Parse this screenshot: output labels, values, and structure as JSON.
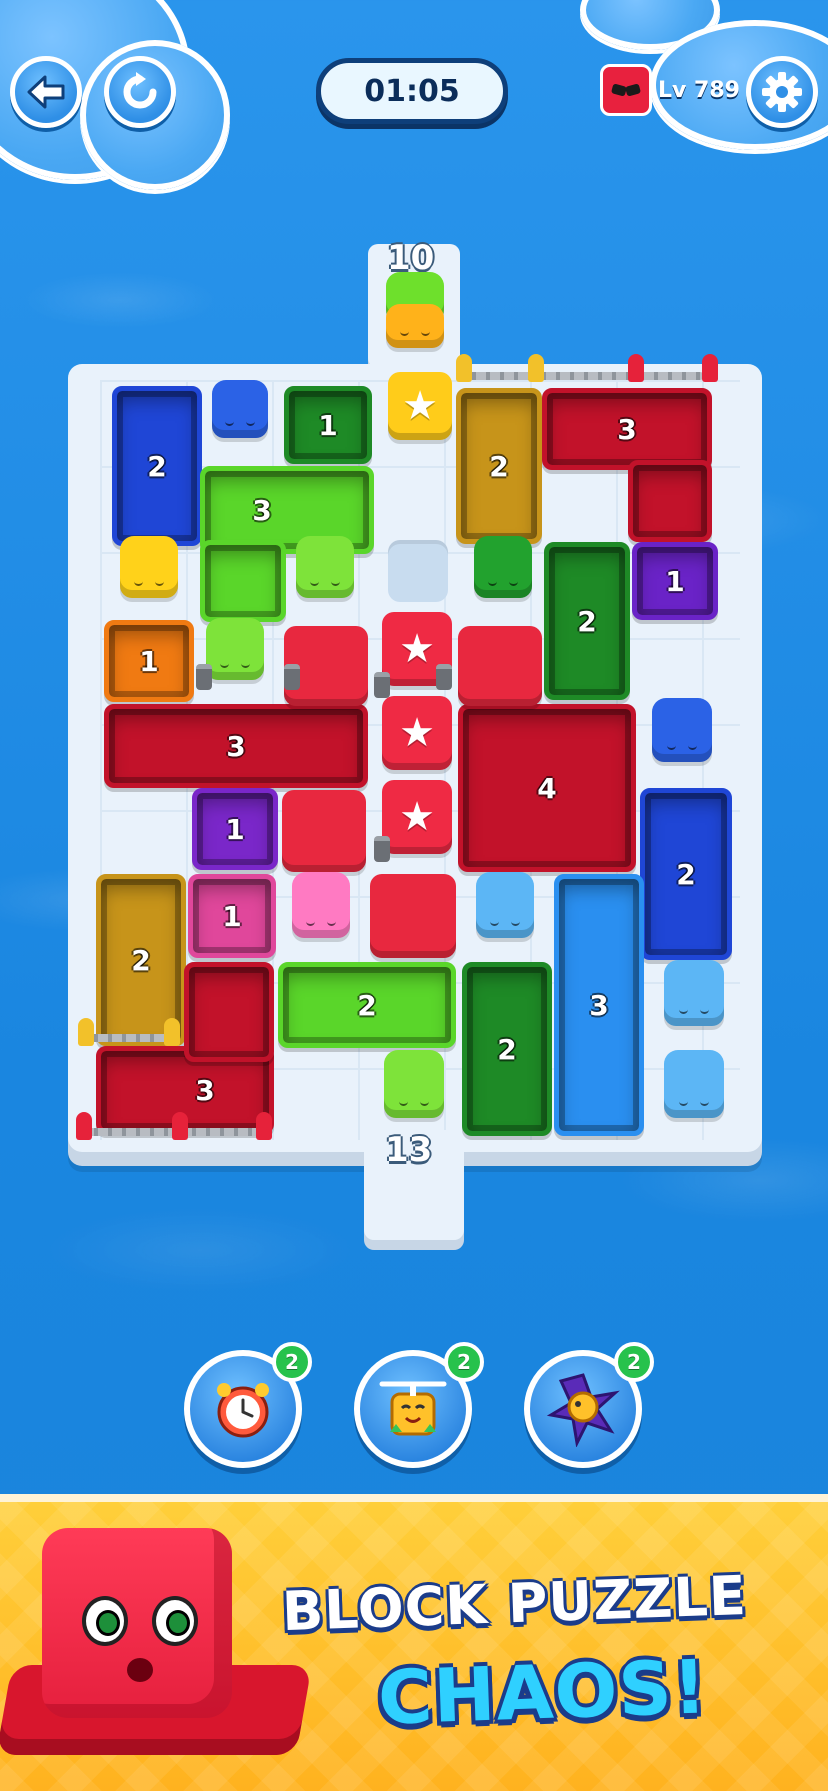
{
  "hud": {
    "timer": "01:05",
    "level": "Lv 789",
    "back_icon": "back-arrow-icon",
    "restart_icon": "restart-icon",
    "settings_icon": "gear-icon"
  },
  "gates": {
    "top_count": "10",
    "bottom_count": "13"
  },
  "blocks": [
    {
      "id": "b1",
      "label": "2",
      "color": "#1f46d6"
    },
    {
      "id": "b2",
      "label": "1",
      "color": "#1e8a26"
    },
    {
      "id": "b3",
      "label": "3",
      "color": "#5ad62a"
    },
    {
      "id": "b4",
      "label": "2",
      "color": "#c7941a"
    },
    {
      "id": "b5",
      "label": "3",
      "color": "#c2122a"
    },
    {
      "id": "b6",
      "label": "2",
      "color": "#1e8a26"
    },
    {
      "id": "b7",
      "label": "1",
      "color": "#6a23c7"
    },
    {
      "id": "b8",
      "label": "1",
      "color": "#f07a12"
    },
    {
      "id": "b9",
      "label": "3",
      "color": "#c2122a"
    },
    {
      "id": "b10",
      "label": "4",
      "color": "#c2122a"
    },
    {
      "id": "b11",
      "label": "1",
      "color": "#7a27c9"
    },
    {
      "id": "b12",
      "label": "2",
      "color": "#1f46d6"
    },
    {
      "id": "b13",
      "label": "2",
      "color": "#c7941a"
    },
    {
      "id": "b14",
      "label": "1",
      "color": "#e0479b"
    },
    {
      "id": "b15",
      "label": "3",
      "color": "#c2122a"
    },
    {
      "id": "b16",
      "label": "2",
      "color": "#5ad62a"
    },
    {
      "id": "b17",
      "label": "2",
      "color": "#1e8a26"
    },
    {
      "id": "b18",
      "label": "3",
      "color": "#2a8ff0"
    }
  ],
  "boosters": [
    {
      "name": "time-freeze-booster",
      "icon": "alarm-clock-icon",
      "count": "2"
    },
    {
      "name": "helicopter-booster",
      "icon": "propeller-cube-icon",
      "count": "2"
    },
    {
      "name": "smash-booster",
      "icon": "star-burst-icon",
      "count": "2"
    }
  ],
  "banner": {
    "line1": "BLOCK PUZZLE",
    "line2": "CHAOS!"
  }
}
